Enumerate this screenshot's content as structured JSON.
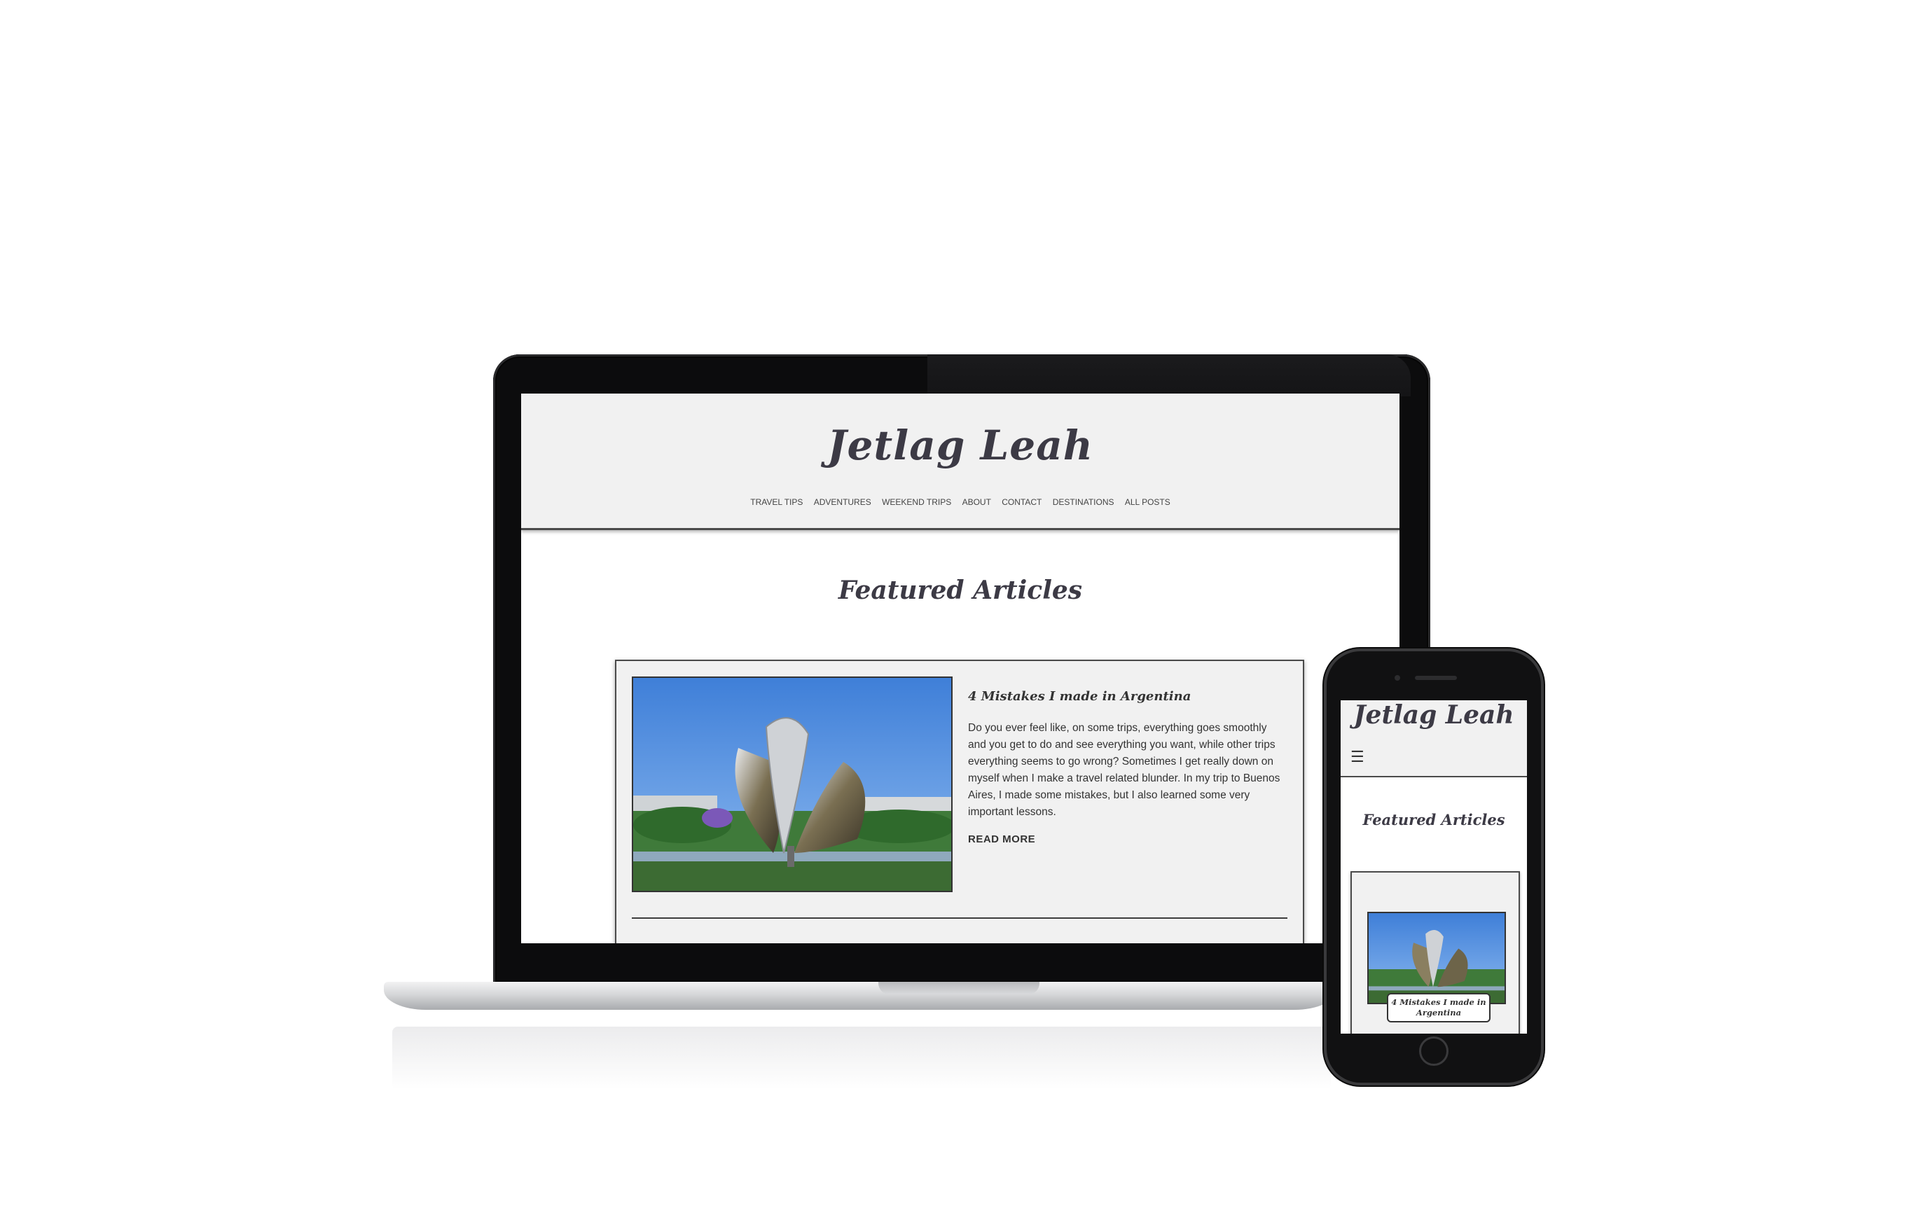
{
  "site": {
    "logo": "Jetlag Leah",
    "nav": [
      "TRAVEL TIPS",
      "ADVENTURES",
      "WEEKEND TRIPS",
      "ABOUT",
      "CONTACT",
      "DESTINATIONS",
      "ALL POSTS"
    ],
    "featured_heading": "Featured Articles"
  },
  "article": {
    "title": "4 Mistakes I made in Argentina",
    "excerpt": "Do you ever feel like, on some trips, everything goes smoothly and you get to do and see everything you want, while other trips everything seems to go wrong? Sometimes I get really down on myself when I make a travel related blunder. In my trip to Buenos Aires, I made some mistakes, but I also learned some very important lessons.",
    "read_more": "READ MORE"
  },
  "mobile": {
    "logo": "Jetlag Leah",
    "menu_icon": "hamburger-icon",
    "featured_heading": "Featured Articles",
    "card_title": "4 Mistakes I made in Argentina"
  },
  "colors": {
    "header_bg": "#f1f1f1",
    "text_dark": "#3c3a45",
    "device_body": "#0c0c0d"
  }
}
